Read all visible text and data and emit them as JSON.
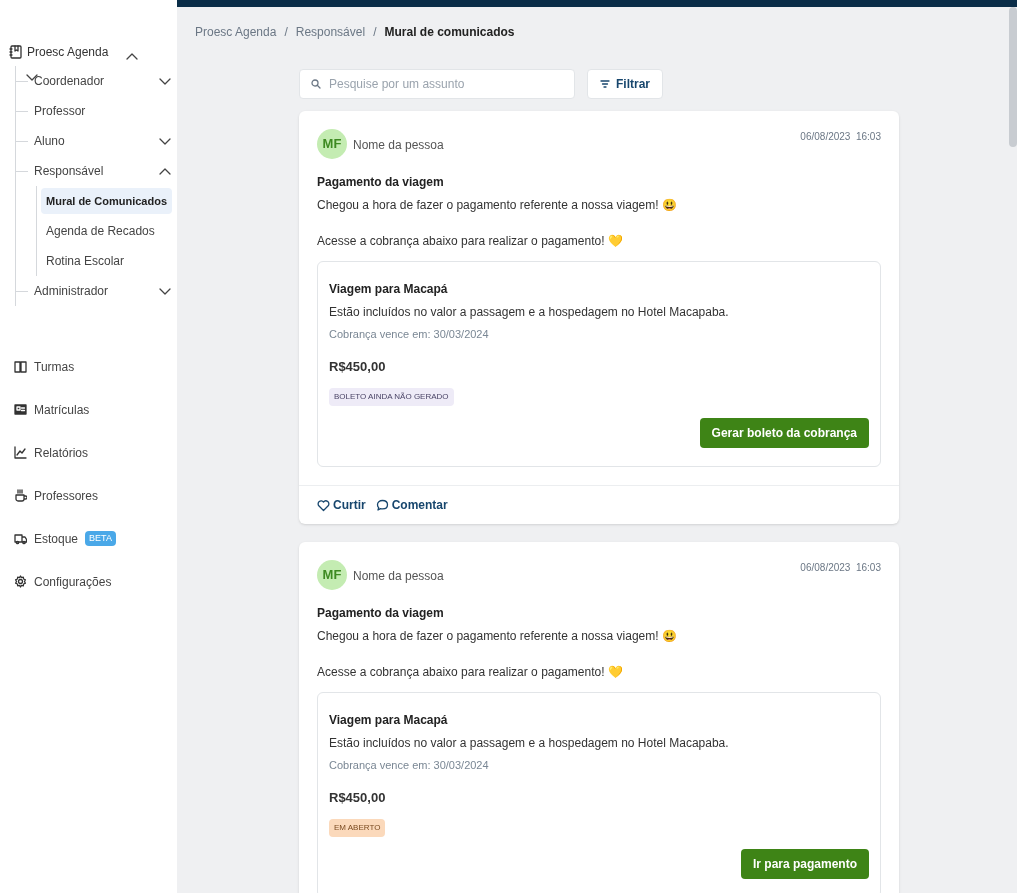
{
  "sidebar": {
    "tree": {
      "label": "Proesc Agenda",
      "expanded": true,
      "children": [
        {
          "label": "Coordenador",
          "expanded": false
        },
        {
          "label": "Professor"
        },
        {
          "label": "Aluno",
          "expanded": false
        },
        {
          "label": "Responsável",
          "expanded": true,
          "children": [
            {
              "label": "Mural de Comunicados",
              "selected": true
            },
            {
              "label": "Agenda de Recados",
              "selected": false
            },
            {
              "label": "Rotina Escolar",
              "selected": false
            }
          ]
        },
        {
          "label": "Administrador",
          "expanded": false
        }
      ]
    },
    "nav": [
      {
        "kind": "book",
        "label": "Turmas"
      },
      {
        "kind": "card",
        "label": "Matrículas"
      },
      {
        "kind": "chart",
        "label": "Relatórios"
      },
      {
        "kind": "cup",
        "label": "Professores"
      },
      {
        "kind": "truck",
        "label": "Estoque",
        "badge": "BETA"
      },
      {
        "kind": "gear",
        "label": "Configurações"
      }
    ]
  },
  "breadcrumb": {
    "separator": "/",
    "items": [
      "Proesc Agenda",
      "Responsável",
      "Mural de comunicados"
    ]
  },
  "search": {
    "placeholder": "Pesquise por um assunto"
  },
  "filter_button": "Filtrar",
  "posts": [
    {
      "initials": "MF",
      "author": "Nome da pessoa",
      "datetime": "06/08/2023  16:03",
      "title": "Pagamento da viagem",
      "paragraphs": [
        "Chegou a hora de fazer o pagamento referente a nossa viagem! 😃",
        "Acesse a cobrança abaixo para realizar o pagamento! 💛"
      ],
      "charge": {
        "title": "Viagem para Macapá",
        "description": "Estão incluídos no valor a passagem e a hospedagem no Hotel Macapaba.",
        "due": "Cobrança vence em: 30/03/2024",
        "amount": "R$450,00",
        "status": {
          "kind": "not_generated",
          "label": "BOLETO AINDA NÃO GERADO"
        },
        "button": "Gerar boleto da cobrança"
      },
      "actions": [
        "Curtir",
        "Comentar"
      ]
    },
    {
      "initials": "MF",
      "author": "Nome da pessoa",
      "datetime": "06/08/2023  16:03",
      "title": "Pagamento da viagem",
      "paragraphs": [
        "Chegou a hora de fazer o pagamento referente a nossa viagem! 😃",
        "Acesse a cobrança abaixo para realizar o pagamento! 💛"
      ],
      "charge": {
        "title": "Viagem para Macapá",
        "description": "Estão incluídos no valor a passagem e a hospedagem no Hotel Macapaba.",
        "due": "Cobrança vence em: 30/03/2024",
        "amount": "R$450,00",
        "status": {
          "kind": "open",
          "label": "EM ABERTO"
        },
        "button": "Ir para pagamento"
      }
    }
  ]
}
